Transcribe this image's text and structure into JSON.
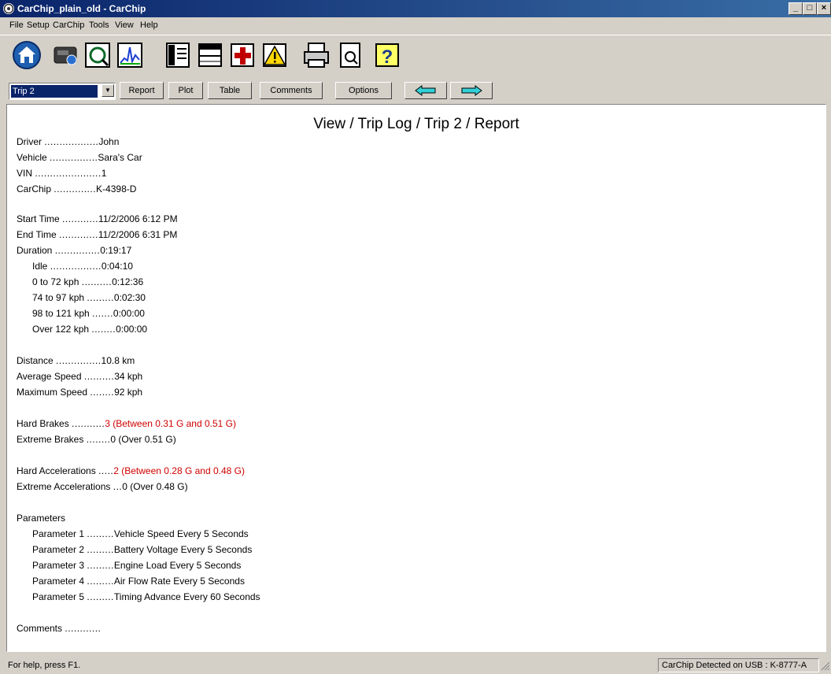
{
  "window": {
    "title": "CarChip_plain_old - CarChip"
  },
  "menu": [
    "File",
    "Setup",
    "CarChip",
    "Tools",
    "View",
    "Help"
  ],
  "toolbar_icons": [
    "home-icon",
    "carchip-device-icon",
    "inspect-icon",
    "graph-icon",
    "notebook-icon",
    "table-icon",
    "health-icon",
    "warning-icon",
    "print-icon",
    "print-preview-icon",
    "help-icon"
  ],
  "nav": {
    "trip_selected": "Trip 2",
    "report_label": "Report",
    "plot_label": "Plot",
    "table_label": "Table",
    "comments_label": "Comments",
    "options_label": "Options"
  },
  "report": {
    "title": "View / Trip Log / Trip 2 / Report",
    "rows": [
      {
        "label": "Driver",
        "dots": "..................",
        "value": "John"
      },
      {
        "label": "Vehicle",
        "dots": "................",
        "value": "Sara's Car"
      },
      {
        "label": "VIN",
        "dots": "......................",
        "value": "1"
      },
      {
        "label": "CarChip",
        "dots": "..............",
        "value": "K-4398-D"
      },
      {
        "label": "Start Time",
        "dots": "............",
        "value": "11/2/2006 6:12 PM"
      },
      {
        "label": "End Time",
        "dots": ".............",
        "value": "11/2/2006 6:31 PM"
      },
      {
        "label": "Duration",
        "dots": "...............",
        "value": "0:19:17"
      },
      {
        "label": "Idle",
        "dots": ".................",
        "value": "0:04:10"
      },
      {
        "label": "0 to 72 kph",
        "dots": "..........",
        "value": "0:12:36"
      },
      {
        "label": "74 to 97 kph",
        "dots": ".........",
        "value": "0:02:30"
      },
      {
        "label": "98 to 121 kph",
        "dots": ".......",
        "value": "0:00:00"
      },
      {
        "label": "Over 122 kph",
        "dots": "........",
        "value": "0:00:00"
      },
      {
        "label": "Distance",
        "dots": "...............",
        "value": "10.8 km"
      },
      {
        "label": "Average Speed",
        "dots": "..........",
        "value": "34 kph"
      },
      {
        "label": "Maximum Speed",
        "dots": "........",
        "value": "92 kph"
      },
      {
        "label": "Hard Brakes",
        "dots": "...........",
        "value": "3 (Between 0.31 G and 0.51 G)"
      },
      {
        "label": "Extreme Brakes",
        "dots": "........",
        "value": "0 (Over 0.51 G)"
      },
      {
        "label": "Hard Accelerations",
        "dots": ".....",
        "value": "2 (Between 0.28 G and 0.48 G)"
      },
      {
        "label": "Extreme Accelerations",
        "dots": "...",
        "value": "0 (Over 0.48 G)"
      },
      {
        "label": "Parameters",
        "dots": "",
        "value": ""
      },
      {
        "label": "Parameter 1",
        "dots": ".........",
        "value": "Vehicle Speed Every 5 Seconds"
      },
      {
        "label": "Parameter 2",
        "dots": ".........",
        "value": "Battery Voltage Every 5 Seconds"
      },
      {
        "label": "Parameter 3",
        "dots": ".........",
        "value": "Engine Load Every 5 Seconds"
      },
      {
        "label": "Parameter 4",
        "dots": ".........",
        "value": "Air Flow Rate Every 5 Seconds"
      },
      {
        "label": "Parameter 5",
        "dots": ".........",
        "value": "Timing Advance Every 60 Seconds"
      },
      {
        "label": "Comments",
        "dots": "............",
        "value": ""
      }
    ],
    "highlight_color": "#d00000"
  },
  "status": {
    "help": "For help, press F1.",
    "device": "CarChip Detected on USB : K-8777-A"
  }
}
